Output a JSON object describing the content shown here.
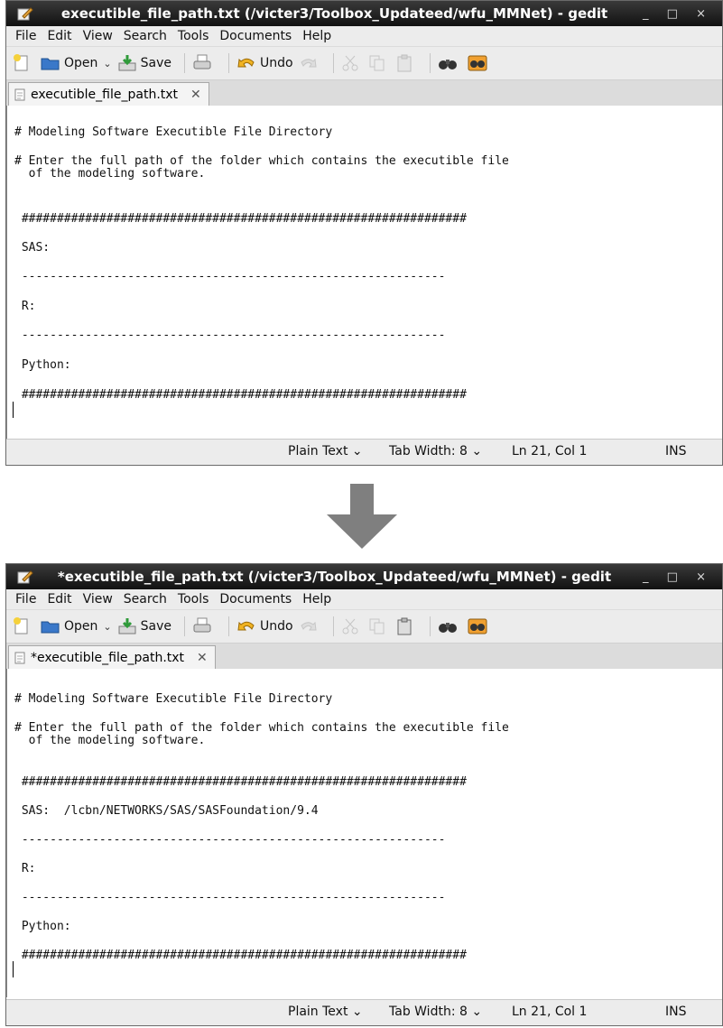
{
  "before": {
    "window_title": "executible_file_path.txt (/victer3/Toolbox_Updateed/wfu_MMNet) - gedit",
    "tab_label": "executible_file_path.txt",
    "lines": [
      "# Modeling Software Executible File Directory",
      "# Enter the full path of the folder which contains the executible file",
      "  of the modeling software.",
      " ###############################################################",
      " SAS:",
      " ------------------------------------------------------------",
      " R:",
      " ------------------------------------------------------------",
      " Python:",
      " ###############################################################"
    ]
  },
  "after": {
    "window_title": "*executible_file_path.txt (/victer3/Toolbox_Updateed/wfu_MMNet) - gedit",
    "tab_label": "*executible_file_path.txt",
    "lines": [
      "# Modeling Software Executible File Directory",
      "# Enter the full path of the folder which contains the executible file",
      "  of the modeling software.",
      " ###############################################################",
      " SAS:  /lcbn/NETWORKS/SAS/SASFoundation/9.4",
      " ------------------------------------------------------------",
      " R:",
      " ------------------------------------------------------------",
      " Python:",
      " ###############################################################"
    ]
  },
  "menu": [
    "File",
    "Edit",
    "View",
    "Search",
    "Tools",
    "Documents",
    "Help"
  ],
  "toolbar": {
    "open_label": "Open",
    "save_label": "Save",
    "undo_label": "Undo"
  },
  "window_controls": "_ □ ×",
  "tab_close": "✕",
  "status": {
    "language": "Plain Text ⌄",
    "tab_width": "Tab Width:  8 ⌄",
    "position": "Ln 21, Col 1",
    "mode": "INS"
  },
  "colors": {
    "arrow": "#7f7f7f",
    "titlebar": "#1c1c1c"
  }
}
